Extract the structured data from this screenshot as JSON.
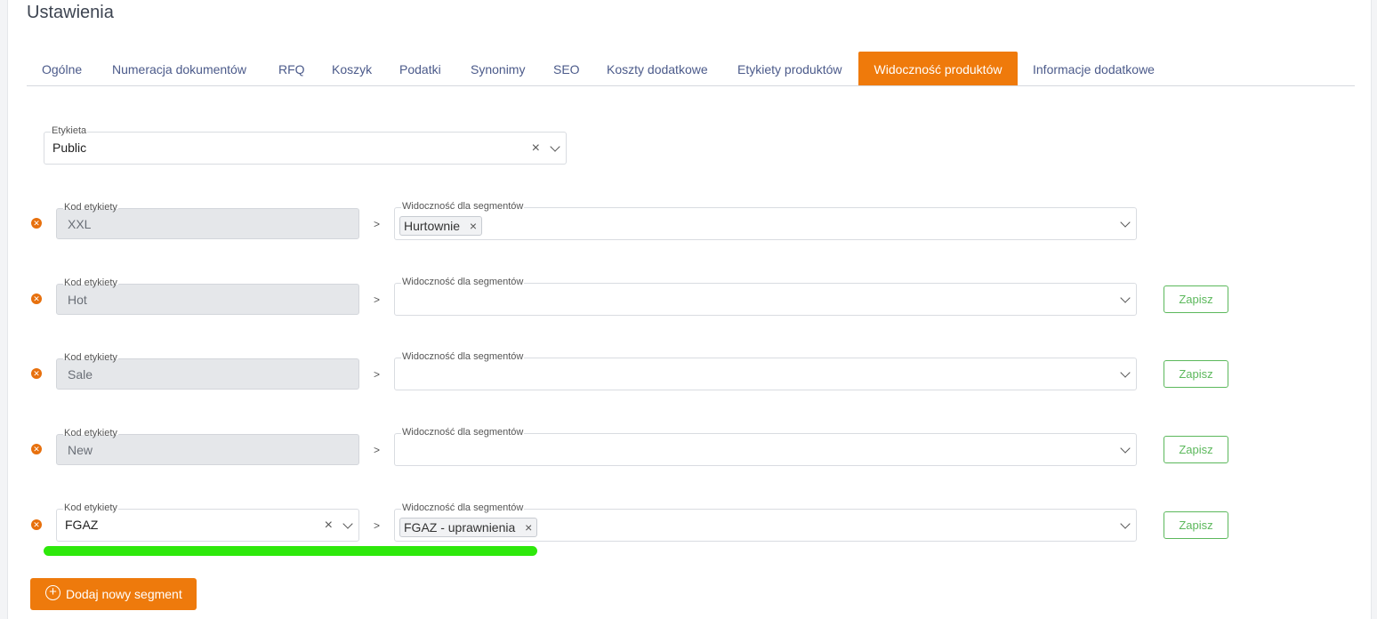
{
  "page": {
    "title": "Ustawienia"
  },
  "tabs": [
    {
      "label": "Ogólne"
    },
    {
      "label": "Numeracja dokumentów"
    },
    {
      "label": "RFQ"
    },
    {
      "label": "Koszyk"
    },
    {
      "label": "Podatki"
    },
    {
      "label": "Synonimy"
    },
    {
      "label": "SEO"
    },
    {
      "label": "Koszty dodatkowe"
    },
    {
      "label": "Etykiety produktów"
    },
    {
      "label": "Widoczność produktów",
      "active": true
    },
    {
      "label": "Informacje dodatkowe"
    }
  ],
  "label_select": {
    "legend": "Etykieta",
    "value": "Public"
  },
  "rows": [
    {
      "code_legend": "Kod etykiety",
      "code": "XXL",
      "separator": ">",
      "segments_legend": "Widoczność dla segmentów",
      "segments": [
        "Hurtownie"
      ],
      "save": null
    },
    {
      "code_legend": "Kod etykiety",
      "code": "Hot",
      "separator": ">",
      "segments_legend": "Widoczność dla segmentów",
      "segments": [],
      "save": "Zapisz"
    },
    {
      "code_legend": "Kod etykiety",
      "code": "Sale",
      "separator": ">",
      "segments_legend": "Widoczność dla segmentów",
      "segments": [],
      "save": "Zapisz"
    },
    {
      "code_legend": "Kod etykiety",
      "code": "New",
      "separator": ">",
      "segments_legend": "Widoczność dla segmentów",
      "segments": [],
      "save": "Zapisz"
    },
    {
      "code_legend": "Kod etykiety",
      "code": "FGAZ",
      "separator": ">",
      "segments_legend": "Widoczność dla segmentów",
      "segments": [
        "FGAZ - uprawnienia"
      ],
      "save": "Zapisz"
    }
  ],
  "add_button": {
    "label": "Dodaj nowy segment"
  },
  "colors": {
    "accent": "#ef7a0b",
    "save": "#5cb85c",
    "highlight": "#2ee80b",
    "tab_text": "#4b5a8a"
  }
}
